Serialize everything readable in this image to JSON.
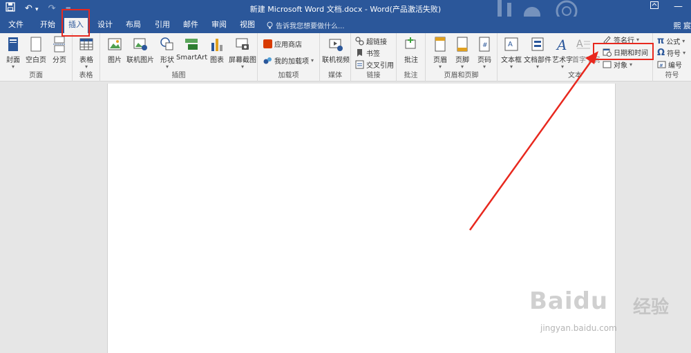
{
  "title_bar": {
    "title": "新建 Microsoft Word 文档.docx - Word(产品激活失败)",
    "user_short": "熙 宸"
  },
  "tabs": [
    {
      "label": "文件"
    },
    {
      "label": "开始"
    },
    {
      "label": "插入",
      "active": true
    },
    {
      "label": "设计"
    },
    {
      "label": "布局"
    },
    {
      "label": "引用"
    },
    {
      "label": "邮件"
    },
    {
      "label": "审阅"
    },
    {
      "label": "视图"
    }
  ],
  "search": {
    "placeholder": "告诉我您想要做什么..."
  },
  "ribbon": {
    "pages": {
      "label": "页面",
      "cover": "封面",
      "blank": "空白页",
      "break": "分页"
    },
    "tables": {
      "label": "表格",
      "table": "表格"
    },
    "illustrations": {
      "label": "插图",
      "picture": "图片",
      "online_picture": "联机图片",
      "shapes": "形状",
      "smartart": "SmartArt",
      "chart": "图表",
      "screenshot": "屏幕截图"
    },
    "addins": {
      "label": "加载项",
      "store": "应用商店",
      "my_addins": "我的加载项"
    },
    "media": {
      "label": "媒体",
      "online_video": "联机视频"
    },
    "links": {
      "label": "链接",
      "hyperlink": "超链接",
      "bookmark": "书签",
      "cross_ref": "交叉引用"
    },
    "comments": {
      "label": "批注",
      "comment": "批注"
    },
    "header_footer": {
      "label": "页眉和页脚",
      "header": "页眉",
      "footer": "页脚",
      "page_number": "页码"
    },
    "text": {
      "label": "文本",
      "textbox": "文本框",
      "quick_parts": "文档部件",
      "wordart": "艺术字",
      "dropcap": "首字下沉",
      "signature": "签名行",
      "datetime": "日期和时间",
      "object": "对象"
    },
    "symbols": {
      "label": "符号",
      "equation": "公式",
      "symbol": "符号",
      "number": "编号"
    }
  },
  "watermark": {
    "brand": "Baidu",
    "brand_cn": "经验",
    "url": "jingyan.baidu.com"
  },
  "colors": {
    "accent": "#2b579a",
    "highlight": "#e8281e"
  }
}
